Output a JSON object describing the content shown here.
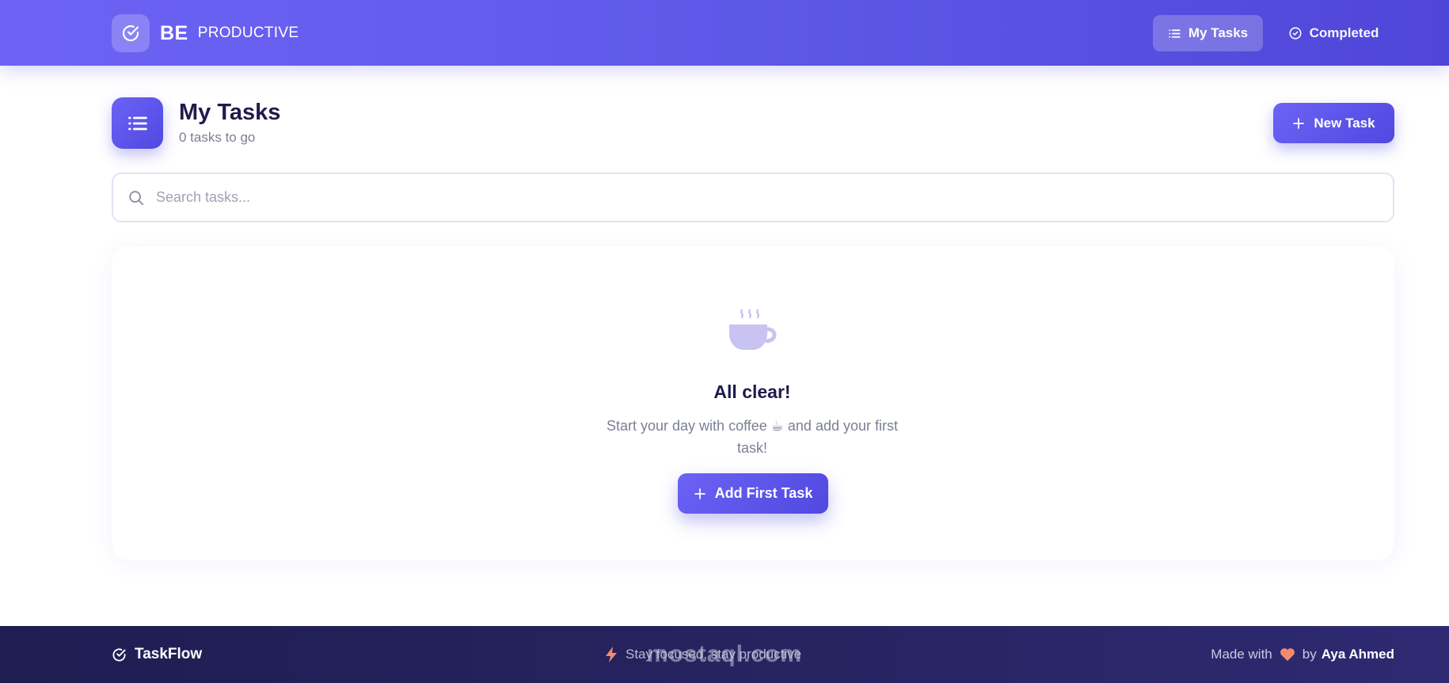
{
  "header": {
    "brand_bold": "BE",
    "brand_light": "PRODUCTIVE",
    "nav": [
      {
        "label": "My Tasks",
        "icon": "list-icon",
        "active": true
      },
      {
        "label": "Completed",
        "icon": "check-circle-icon",
        "active": false
      }
    ]
  },
  "page": {
    "title": "My Tasks",
    "subtitle": "0 tasks to go",
    "new_task_label": "New Task"
  },
  "search": {
    "placeholder": "Search tasks...",
    "value": ""
  },
  "empty_state": {
    "icon": "coffee-cup-icon",
    "title": "All clear!",
    "description": "Start your day with coffee ☕ and add your first task!",
    "button_label": "Add First Task"
  },
  "footer": {
    "brand": "TaskFlow",
    "tagline": "Stay focused, stay productive",
    "credit_prefix": "Made with",
    "credit_by": "by",
    "author": "Aya Ahmed"
  },
  "watermark": {
    "text": "mostaql.com"
  },
  "colors": {
    "accent": "#5d57e6",
    "footer_bg": "#27235f",
    "heart": "#f28b6b",
    "bolt": "#f28b6b"
  }
}
